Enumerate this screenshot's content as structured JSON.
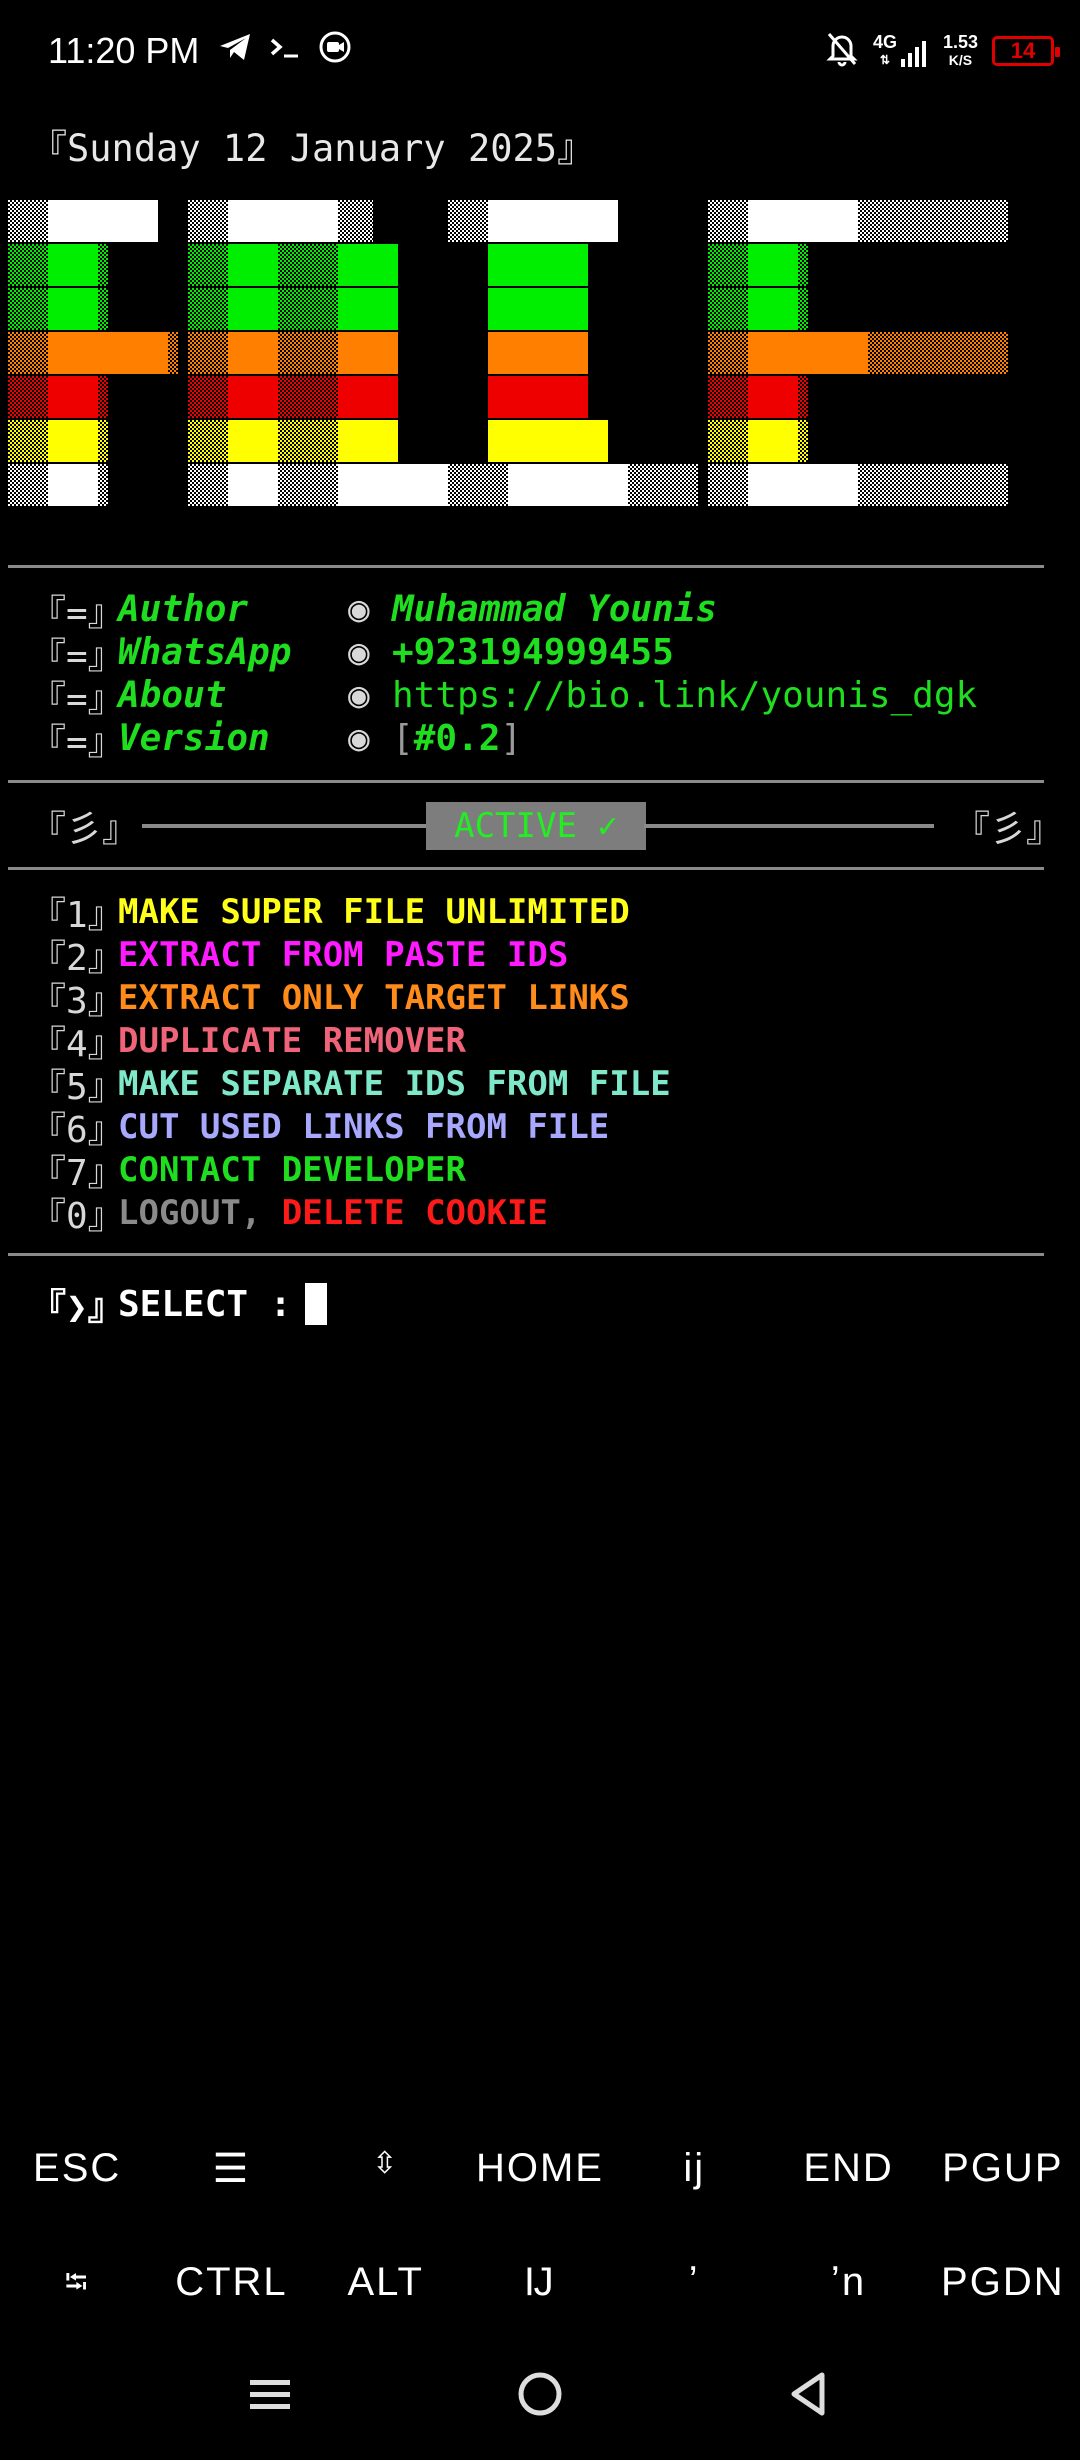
{
  "status_bar": {
    "time": "11:20 PM",
    "network_type": "4G",
    "speed_value": "1.53",
    "speed_unit": "K/S",
    "battery": "14",
    "icons_left": [
      "telegram-icon",
      "terminal-icon",
      "recorder-icon"
    ],
    "icons_right": [
      "bell-off-icon",
      "signal-icon",
      "battery-icon"
    ]
  },
  "terminal": {
    "date_line": "『Sunday 12 January 2025』",
    "banner_text": "FILE",
    "info": [
      {
        "bracket": "『=』",
        "key": "Author",
        "bullet": "◉",
        "value": "Muhammad Younis",
        "italic": true
      },
      {
        "bracket": "『=』",
        "key": "WhatsApp",
        "bullet": "◉",
        "value": "+923194999455",
        "italic": false
      },
      {
        "bracket": "『=』",
        "key": "About",
        "bullet": "◉",
        "value": "https://bio.link/younis_dgk",
        "italic": false
      },
      {
        "bracket": "『=』",
        "key": "Version",
        "bullet": "◉",
        "value_open": "[",
        "value": "#0.2",
        "value_close": "]",
        "italic": false
      }
    ],
    "status": {
      "left_mark": "『彡』",
      "badge": "ACTIVE ✓",
      "right_mark": "『彡』"
    },
    "menu": [
      {
        "num": "『1』",
        "label": "MAKE SUPER FILE UNLIMITED",
        "color": "#ffff1a"
      },
      {
        "num": "『2』",
        "label": "EXTRACT FROM PASTE IDS",
        "color": "#ff1aff"
      },
      {
        "num": "『3』",
        "label": "EXTRACT ONLY TARGET LINKS",
        "color": "#ff8c1a"
      },
      {
        "num": "『4』",
        "label": "DUPLICATE REMOVER",
        "color": "#f0647a"
      },
      {
        "num": "『5』",
        "label": "MAKE SEPARATE IDS FROM FILE",
        "color": "#7fe8c8"
      },
      {
        "num": "『6』",
        "label": "CUT USED LINKS FROM FILE",
        "color": "#a8a8ff"
      },
      {
        "num": "『7』",
        "label": "CONTACT DEVELOPER",
        "color": "#1fde1f"
      },
      {
        "num": "『0』",
        "label_a": "LOGOUT,",
        "color_a": "#8a8a8a",
        "label_b": "DELETE COOKIE",
        "color_b": "#ff1a1a"
      }
    ],
    "prompt": {
      "mark": "『❯』",
      "label": "SELECT :"
    }
  },
  "extra_keys": {
    "row1": [
      "ESC",
      "☰",
      "⇳",
      "HOME",
      "ij",
      "END",
      "PGUP"
    ],
    "row2": [
      "⭾",
      "CTRL",
      "ALT",
      "Ĳ",
      "ʼ",
      "ʼn",
      "PGDN"
    ]
  },
  "colors": {
    "green": "#1fde1f",
    "banner_white": "#ffffff",
    "banner_green": "#00ee00",
    "banner_orange": "#ff8000",
    "banner_red": "#ee0000",
    "banner_yellow": "#ffff00"
  }
}
